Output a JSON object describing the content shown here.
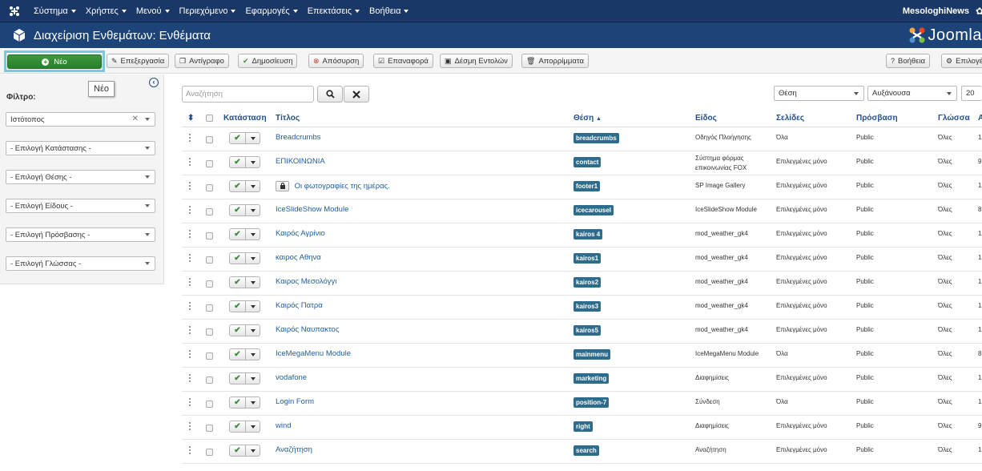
{
  "topbar": {
    "menu": [
      "Σύστημα",
      "Χρήστες",
      "Μενού",
      "Περιεχόμενο",
      "Εφαρμογές",
      "Επεκτάσεις",
      "Βοήθεια"
    ],
    "site_name": "MesologhiNews",
    "site_icon": "external-link-icon",
    "settings_icon": "gear-icon"
  },
  "titlebar": {
    "title": "Διαχείριση Ενθεμάτων: Ενθέματα",
    "brand": "Joomla"
  },
  "toolbar": {
    "new": "Νέο",
    "edit": "Επεξεργασία",
    "copy": "Αντίγραφο",
    "publish": "Δημοσίευση",
    "unpublish": "Απόσυρση",
    "checkin": "Επαναφορά",
    "batch": "Δέσμη Εντολών",
    "trash": "Απορρίμματα",
    "help": "Βοήθεια",
    "options": "Επιλογές"
  },
  "tooltip": "Νέο",
  "sidebar": {
    "filter_label": "Φίλτρο:",
    "client_select": "Ιστότοπος",
    "state_select": "- Επιλογή Κατάστασης -",
    "position_select": "- Επιλογή Θέσης -",
    "type_select": "- Επιλογή Είδους -",
    "access_select": "- Επιλογή Πρόσβασης -",
    "language_select": "- Επιλογή Γλώσσας -"
  },
  "search": {
    "placeholder": "Αναζήτηση",
    "sort_field": "Θέση",
    "sort_dir": "Αυξάνουσα",
    "limit": "20"
  },
  "columns": {
    "status": "Κατάσταση",
    "title": "Τίτλος",
    "position": "Θέση",
    "type": "Είδος",
    "pages": "Σελίδες",
    "access": "Πρόσβαση",
    "language": "Γλώσσα",
    "id_trunc": "Α"
  },
  "rows": [
    {
      "title": "Breadcrumbs",
      "position": "breadcrumbs",
      "type": "Οδηγός Πλοήγησης",
      "type2": "",
      "pages": "Όλα",
      "access": "Public",
      "lang": "Όλες",
      "id": "1",
      "locked": false
    },
    {
      "title": "ΕΠΙΚΟΙΝΩΝΙΑ",
      "position": "contact",
      "type": "Σύστημα φόρμας",
      "type2": "επικοινωνίας FOX",
      "pages": "Επιλεγμένες μόνο",
      "access": "Public",
      "lang": "Όλες",
      "id": "9",
      "locked": false
    },
    {
      "title": "Οι φωτογραφίες της ημέρας.",
      "position": "footer1",
      "type": "SP Image Gallery",
      "type2": "",
      "pages": "Επιλεγμένες μόνο",
      "access": "Public",
      "lang": "Όλες",
      "id": "1",
      "locked": true
    },
    {
      "title": "IceSlideShow Module",
      "position": "icecarousel",
      "type": "IceSlideShow Module",
      "type2": "",
      "pages": "Επιλεγμένες μόνο",
      "access": "Public",
      "lang": "Όλες",
      "id": "8",
      "locked": false
    },
    {
      "title": "Καιρός Αγρίνιο",
      "position": "kairos 4",
      "type": "mod_weather_gk4",
      "type2": "",
      "pages": "Επιλεγμένες μόνο",
      "access": "Public",
      "lang": "Όλες",
      "id": "1",
      "locked": false
    },
    {
      "title": "καιρος Αθηνα",
      "position": "kairos1",
      "type": "mod_weather_gk4",
      "type2": "",
      "pages": "Επιλεγμένες μόνο",
      "access": "Public",
      "lang": "Όλες",
      "id": "1",
      "locked": false
    },
    {
      "title": "Καιρος Μεσολόγγι",
      "position": "kairos2",
      "type": "mod_weather_gk4",
      "type2": "",
      "pages": "Επιλεγμένες μόνο",
      "access": "Public",
      "lang": "Όλες",
      "id": "1",
      "locked": false
    },
    {
      "title": "Καιρός Πατρα",
      "position": "kairos3",
      "type": "mod_weather_gk4",
      "type2": "",
      "pages": "Επιλεγμένες μόνο",
      "access": "Public",
      "lang": "Όλες",
      "id": "1",
      "locked": false
    },
    {
      "title": "Καιρός Ναυπακτος",
      "position": "kairos5",
      "type": "mod_weather_gk4",
      "type2": "",
      "pages": "Επιλεγμένες μόνο",
      "access": "Public",
      "lang": "Όλες",
      "id": "1",
      "locked": false
    },
    {
      "title": "IceMegaMenu Module",
      "position": "mainmenu",
      "type": "IceMegaMenu Module",
      "type2": "",
      "pages": "Όλα",
      "access": "Public",
      "lang": "Όλες",
      "id": "8",
      "locked": false
    },
    {
      "title": "vodafone",
      "position": "marketing",
      "type": "Διαφημίσεις",
      "type2": "",
      "pages": "Επιλεγμένες μόνο",
      "access": "Public",
      "lang": "Όλες",
      "id": "1",
      "locked": false
    },
    {
      "title": "Login Form",
      "position": "position-7",
      "type": "Σύνδεση",
      "type2": "",
      "pages": "Όλα",
      "access": "Public",
      "lang": "Όλες",
      "id": "1",
      "locked": false
    },
    {
      "title": "wind",
      "position": "right",
      "type": "Διαφημίσεις",
      "type2": "",
      "pages": "Επιλεγμένες μόνο",
      "access": "Public",
      "lang": "Όλες",
      "id": "9",
      "locked": false
    },
    {
      "title": "Αναζήτηση",
      "position": "search",
      "type": "Αναζήτηση",
      "type2": "",
      "pages": "Επιλεγμένες μόνο",
      "access": "Public",
      "lang": "Όλες",
      "id": "1",
      "locked": false
    }
  ],
  "colors": {
    "topbar": "#1a3867",
    "titlebar": "#1d4479",
    "new_button": "#2d7d2d",
    "position_badge": "#2d6c8c",
    "link": "#1f5ea5",
    "highlight": "#7ac9dd"
  }
}
